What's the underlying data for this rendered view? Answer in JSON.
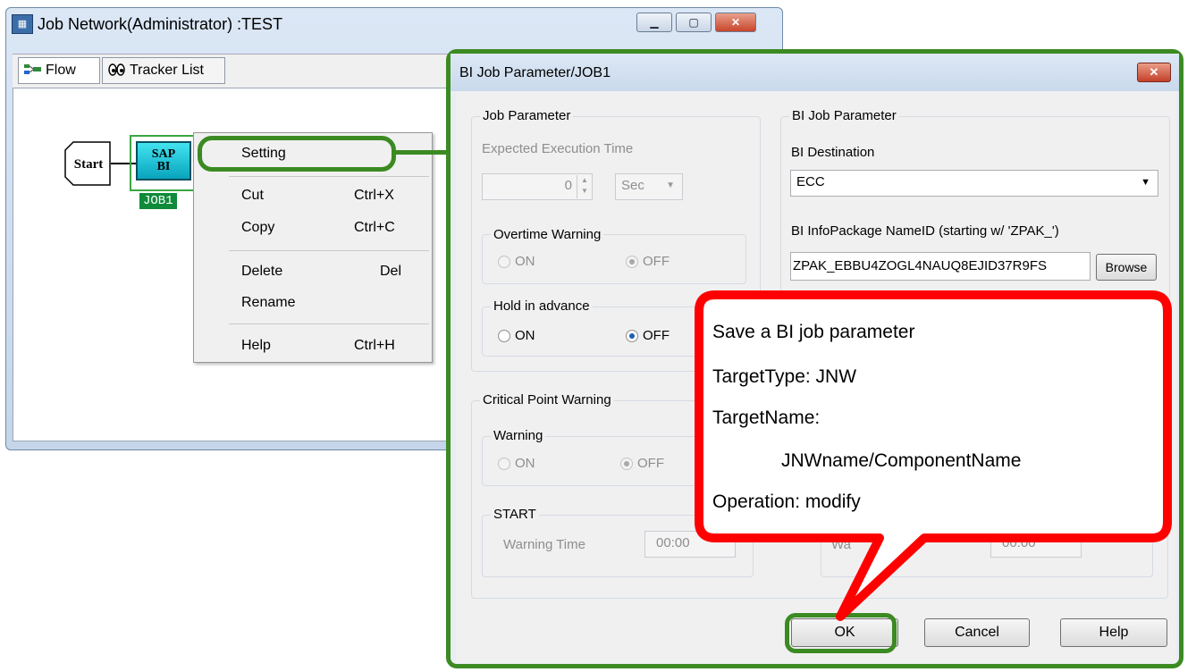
{
  "jnw": {
    "title": "Job Network(Administrator) :TEST",
    "tabs": [
      "Flow",
      "Tracker List"
    ],
    "nodes": {
      "start": "Start",
      "sap_line1": "SAP",
      "sap_line2": "BI",
      "job_label": "JOB1"
    }
  },
  "context_menu": {
    "items": [
      {
        "label": "Setting",
        "shortcut": ""
      },
      {
        "label": "Cut",
        "shortcut": "Ctrl+X"
      },
      {
        "label": "Copy",
        "shortcut": "Ctrl+C"
      },
      {
        "label": "Delete",
        "shortcut": "Del"
      },
      {
        "label": "Rename",
        "shortcut": ""
      },
      {
        "label": "Help",
        "shortcut": "Ctrl+H"
      }
    ]
  },
  "dialog": {
    "title": "BI Job Parameter/JOB1",
    "job_parameter": {
      "group_label": "Job Parameter",
      "expected_execution_time_label": "Expected Execution Time",
      "time_value": "0",
      "time_unit": "Sec",
      "overtime_warning": {
        "label": "Overtime Warning",
        "on": "ON",
        "off": "OFF",
        "selected": "OFF"
      },
      "hold_in_advance": {
        "label": "Hold in advance",
        "on": "ON",
        "off": "OFF",
        "selected": "OFF"
      }
    },
    "critical_point_warning": {
      "group_label": "Critical Point Warning",
      "warning": {
        "label": "Warning",
        "on": "ON",
        "off": "OFF",
        "selected": "OFF"
      },
      "start": {
        "label": "START",
        "warning_time_label": "Warning Time",
        "warning_time_value": "00:00"
      },
      "end": {
        "warning_time_label_partial": "Wa",
        "warning_time_value": "00:00"
      }
    },
    "bi_job_parameter": {
      "group_label": "BI Job Parameter",
      "destination_label": "BI Destination",
      "destination_value": "ECC",
      "infopackage_label": "BI InfoPackage NameID (starting w/ 'ZPAK_')",
      "infopackage_value": "ZPAK_EBBU4ZOGL4NAUQ8EJID37R9FS",
      "browse_label": "Browse"
    },
    "buttons": {
      "ok": "OK",
      "cancel": "Cancel",
      "help": "Help"
    }
  },
  "callout": {
    "lines": [
      "Save a BI job parameter",
      "TargetType: JNW",
      "TargetName:",
      "JNWname/ComponentName",
      "Operation: modify"
    ]
  },
  "colors": {
    "highlight_green": "#3b8a22",
    "callout_red": "#ff0000"
  }
}
